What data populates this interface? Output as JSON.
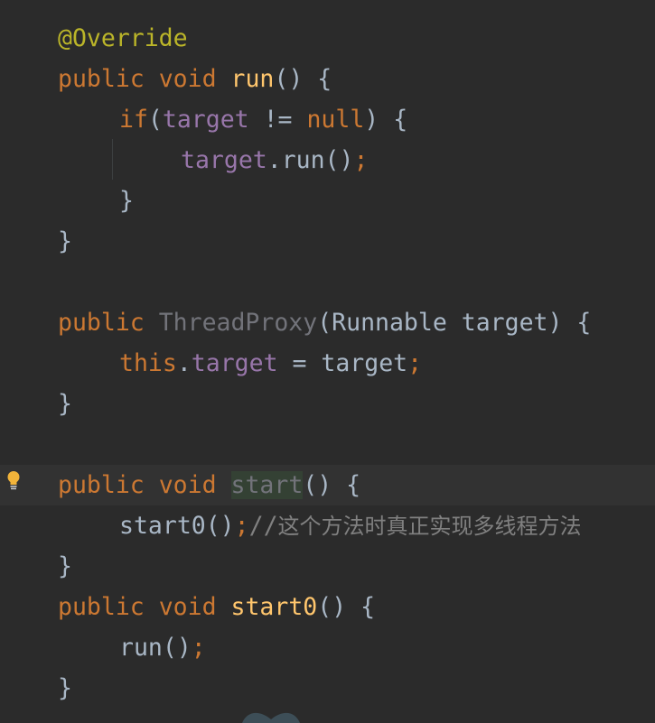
{
  "colors": {
    "background": "#2b2b2b",
    "caret_line": "#323232",
    "annotation": "#bbb529",
    "keyword": "#cc7832",
    "method": "#ffc66d",
    "field": "#9876aa",
    "plain": "#a9b7c6",
    "unused": "#72737a",
    "comment": "#808080",
    "usage_highlight": "#344134",
    "bulb": "#f2b43a"
  },
  "gutter": {
    "icon": "lightbulb-icon"
  },
  "editor": {
    "lines": [
      {
        "annotation": "@Override"
      },
      {
        "k1": "public",
        "k2": "void",
        "method": "run",
        "rest": "() {"
      },
      {
        "kw": "if",
        "p1": "(",
        "field": "target",
        "p2": " != ",
        "null_kw": "null",
        "p3": ") {"
      },
      {
        "field": "target",
        "rest": ".run()",
        "semi": ";"
      },
      {
        "brace": "}"
      },
      {
        "brace": "}"
      },
      {
        "kw": "public",
        "ctor": "ThreadProxy",
        "rest": "(Runnable target) {"
      },
      {
        "this_kw": "this",
        "dot": ".",
        "field": "target",
        "rest": " = target",
        "semi": ";"
      },
      {
        "brace": "}"
      },
      {
        "k1": "public",
        "k2": "void",
        "method": "start",
        "rest": "() {"
      },
      {
        "call": "start0()",
        "semi": ";",
        "comment_slashes": "//",
        "comment_text": "这个方法时真正实现多线程方法"
      },
      {
        "brace": "}"
      },
      {
        "k1": "public",
        "k2": "void",
        "method": "start0",
        "rest": "() {"
      },
      {
        "call": "run()",
        "semi": ";"
      },
      {
        "brace": "}"
      }
    ]
  }
}
